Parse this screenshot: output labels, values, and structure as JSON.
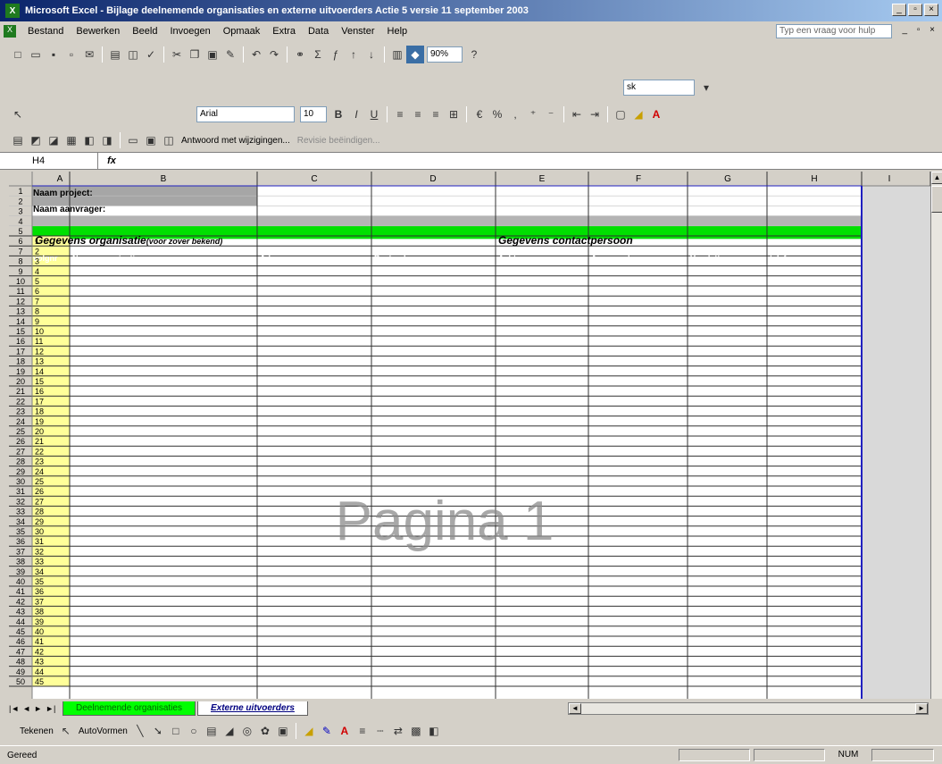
{
  "window": {
    "title": "Microsoft Excel - Bijlage deelnemende organisaties en externe uitvoerders Actie 5 versie 11 september 2003",
    "buttons": [
      "_",
      "▫",
      "×"
    ]
  },
  "menu": {
    "items": [
      "Bestand",
      "Bewerken",
      "Beeld",
      "Invoegen",
      "Opmaak",
      "Extra",
      "Data",
      "Venster",
      "Help"
    ],
    "help_placeholder": "Typ een vraag voor hulp"
  },
  "toolbar": {
    "zoom": "90%",
    "font": "Arial",
    "font_size": "10",
    "style_box": "sk",
    "review_label": "Antwoord met wijzigingen...",
    "review_end": "Revisie beëindigen..."
  },
  "formula_bar": {
    "name_box": "H4",
    "fx": "fx",
    "content": ""
  },
  "sheet": {
    "columns": [
      "A",
      "B",
      "C",
      "D",
      "E",
      "F",
      "G",
      "H",
      "I"
    ],
    "labels": {
      "naam_project": "Naam project:",
      "naam_aanvrager": "Naam aanvrager:",
      "section_org": "Gegevens organisatie",
      "section_org_note": "(voor zover bekend)",
      "section_contact": "Gegevens contactpersoon"
    },
    "headers": [
      "volgnr",
      "Naam organisatie",
      "Adres",
      "Postcode",
      "Achternaam",
      "Aanspreekvorm",
      "Voorletters",
      "telefoonnr"
    ],
    "watermark": "Pagina 1"
  },
  "tabs": {
    "nav": [
      "|◄",
      "◄",
      "►",
      "►|"
    ],
    "items": [
      "Deelnemende organisaties",
      "Externe uitvoerders"
    ]
  },
  "drawing": {
    "tekenen": "Tekenen",
    "autovormen": "AutoVormen"
  },
  "status": {
    "text": "Gereed",
    "num": "NUM"
  }
}
